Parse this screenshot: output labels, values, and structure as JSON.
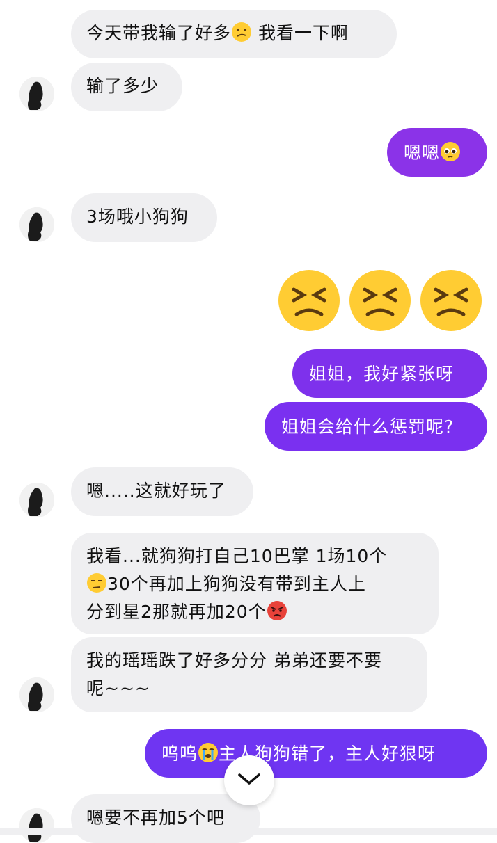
{
  "colors": {
    "outgoing_bubble": "#7b2ff7",
    "incoming_bubble": "#efeff1"
  },
  "messages": [
    {
      "dir": "in",
      "parts": [
        "今天带我输了好多",
        "[confused-face]",
        " 我看一下啊"
      ]
    },
    {
      "dir": "in",
      "text": "输了多少"
    },
    {
      "dir": "out",
      "parts": [
        "嗯嗯",
        "[pleading-face]"
      ]
    },
    {
      "dir": "in",
      "text": "3场哦小狗狗"
    },
    {
      "dir": "out",
      "emoji_only": [
        "persevering-face",
        "persevering-face",
        "persevering-face"
      ]
    },
    {
      "dir": "out",
      "text": "姐姐，我好紧张呀"
    },
    {
      "dir": "out",
      "text": "姐姐会给什么惩罚呢?"
    },
    {
      "dir": "in",
      "text": "嗯.....这就好玩了"
    },
    {
      "dir": "in",
      "line1": "我看...就狗狗打自己10巴掌 1场10个",
      "line2_rest": "30个再加上狗狗没有带到主人上",
      "line3": "分到星2那就再加20个"
    },
    {
      "dir": "in",
      "line1": "我的瑶瑶跌了好多分分 弟弟还要不要",
      "line2": "呢~~~"
    },
    {
      "dir": "out",
      "part1": "呜呜",
      "part2": "主人狗狗错了，主人好狠呀"
    },
    {
      "dir": "in",
      "text": "嗯要不再加5个吧"
    }
  ]
}
